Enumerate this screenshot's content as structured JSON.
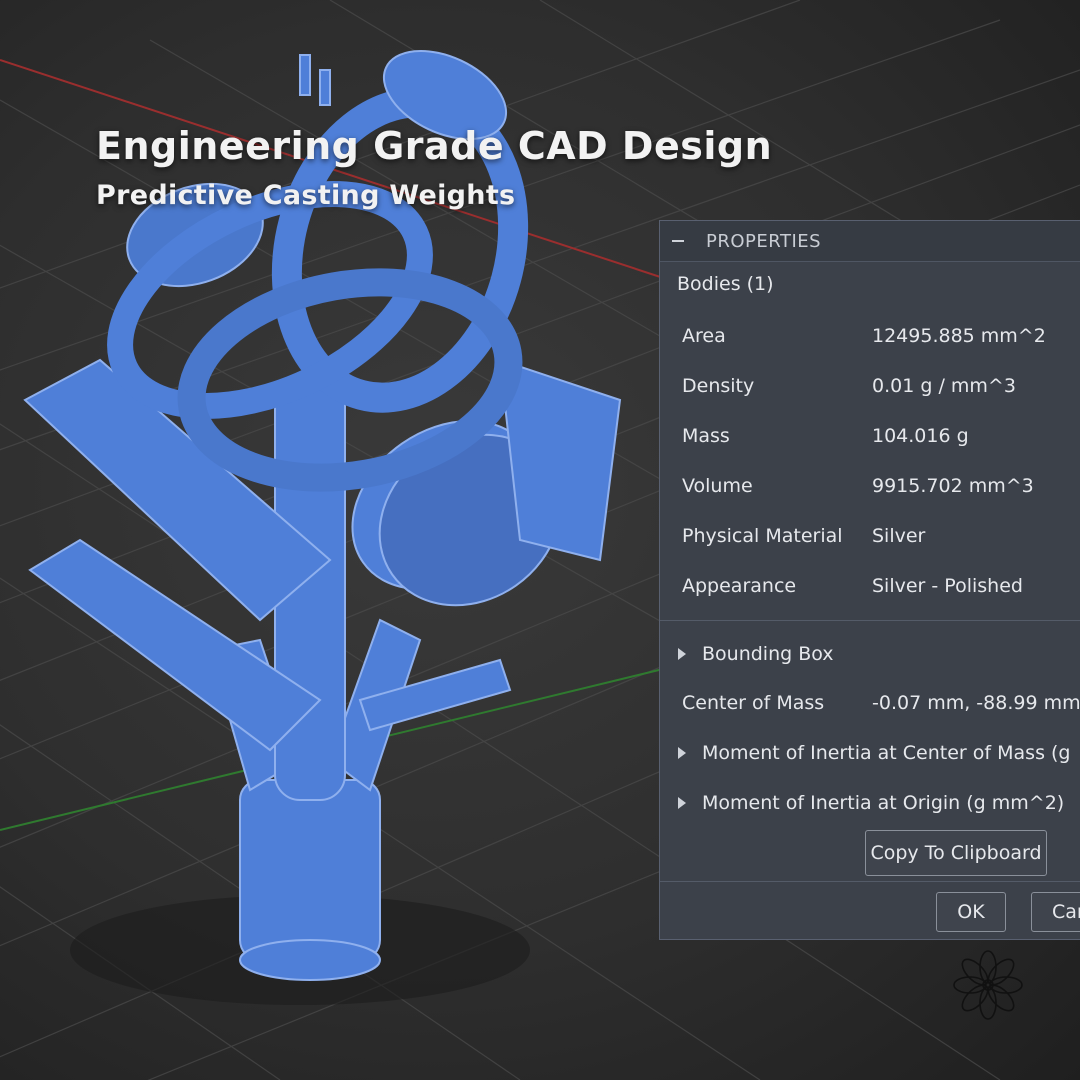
{
  "overlay": {
    "headline": "Engineering Grade CAD Design",
    "subheadline": "Predictive Casting Weights"
  },
  "panel": {
    "title": "PROPERTIES",
    "section": "Bodies (1)",
    "properties": [
      {
        "label": "Area",
        "value": "12495.885 mm^2"
      },
      {
        "label": "Density",
        "value": "0.01 g / mm^3"
      },
      {
        "label": "Mass",
        "value": "104.016 g"
      },
      {
        "label": "Volume",
        "value": "9915.702 mm^3"
      },
      {
        "label": "Physical Material",
        "value": "Silver"
      },
      {
        "label": "Appearance",
        "value": "Silver - Polished"
      }
    ],
    "bounding_box": "Bounding Box",
    "center_of_mass": {
      "label": "Center of Mass",
      "value": "-0.07 mm, -88.99 mm,"
    },
    "moment_center": "Moment of Inertia at Center of Mass   (g",
    "moment_origin": "Moment of Inertia at Origin   (g mm^2)",
    "copy_button": "Copy To Clipboard",
    "ok_button": "OK",
    "cancel_button": "Car"
  },
  "colors": {
    "model": "#4f7fd8",
    "panel_bg": "#3c414a",
    "grid": "#4a4a4a",
    "x_axis": "#9a2e2e",
    "y_axis": "#2f7a2f"
  },
  "icons": {
    "collapse": "minus-icon",
    "expand": "triangle-right-icon",
    "logo": "flower-logo-icon"
  }
}
